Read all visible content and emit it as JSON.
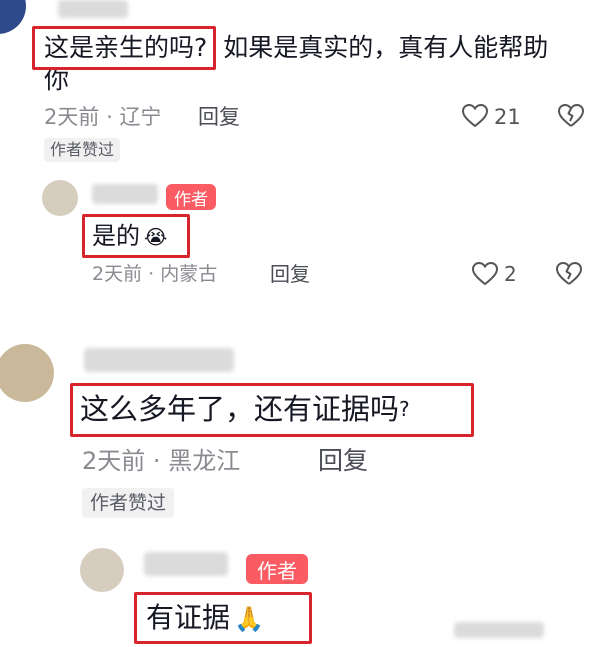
{
  "comments": [
    {
      "text_boxed": "这是亲生的吗?",
      "text_rest_line1": "如果是真实的，真有人能帮助",
      "text_rest_line2": "你",
      "time": "2天前",
      "location": "辽宁",
      "reply_label": "回复",
      "likes": "21",
      "liked_note": "作者赞过"
    },
    {
      "author_tag": "作者",
      "text": "是的",
      "emoji": "😭",
      "time": "2天前",
      "location": "内蒙古",
      "reply_label": "回复",
      "likes": "2"
    },
    {
      "text": "这么多年了，还有证据吗",
      "text_tail": "?",
      "time": "2天前",
      "location": "黑龙江",
      "reply_label": "回复",
      "liked_note": "作者赞过"
    },
    {
      "author_tag": "作者",
      "text": "有证据",
      "emoji": "🙏"
    }
  ],
  "separator": "·",
  "colors": {
    "highlight": "#d7242d",
    "author_tag": "#fb5b62",
    "meta": "#8a8b91"
  }
}
